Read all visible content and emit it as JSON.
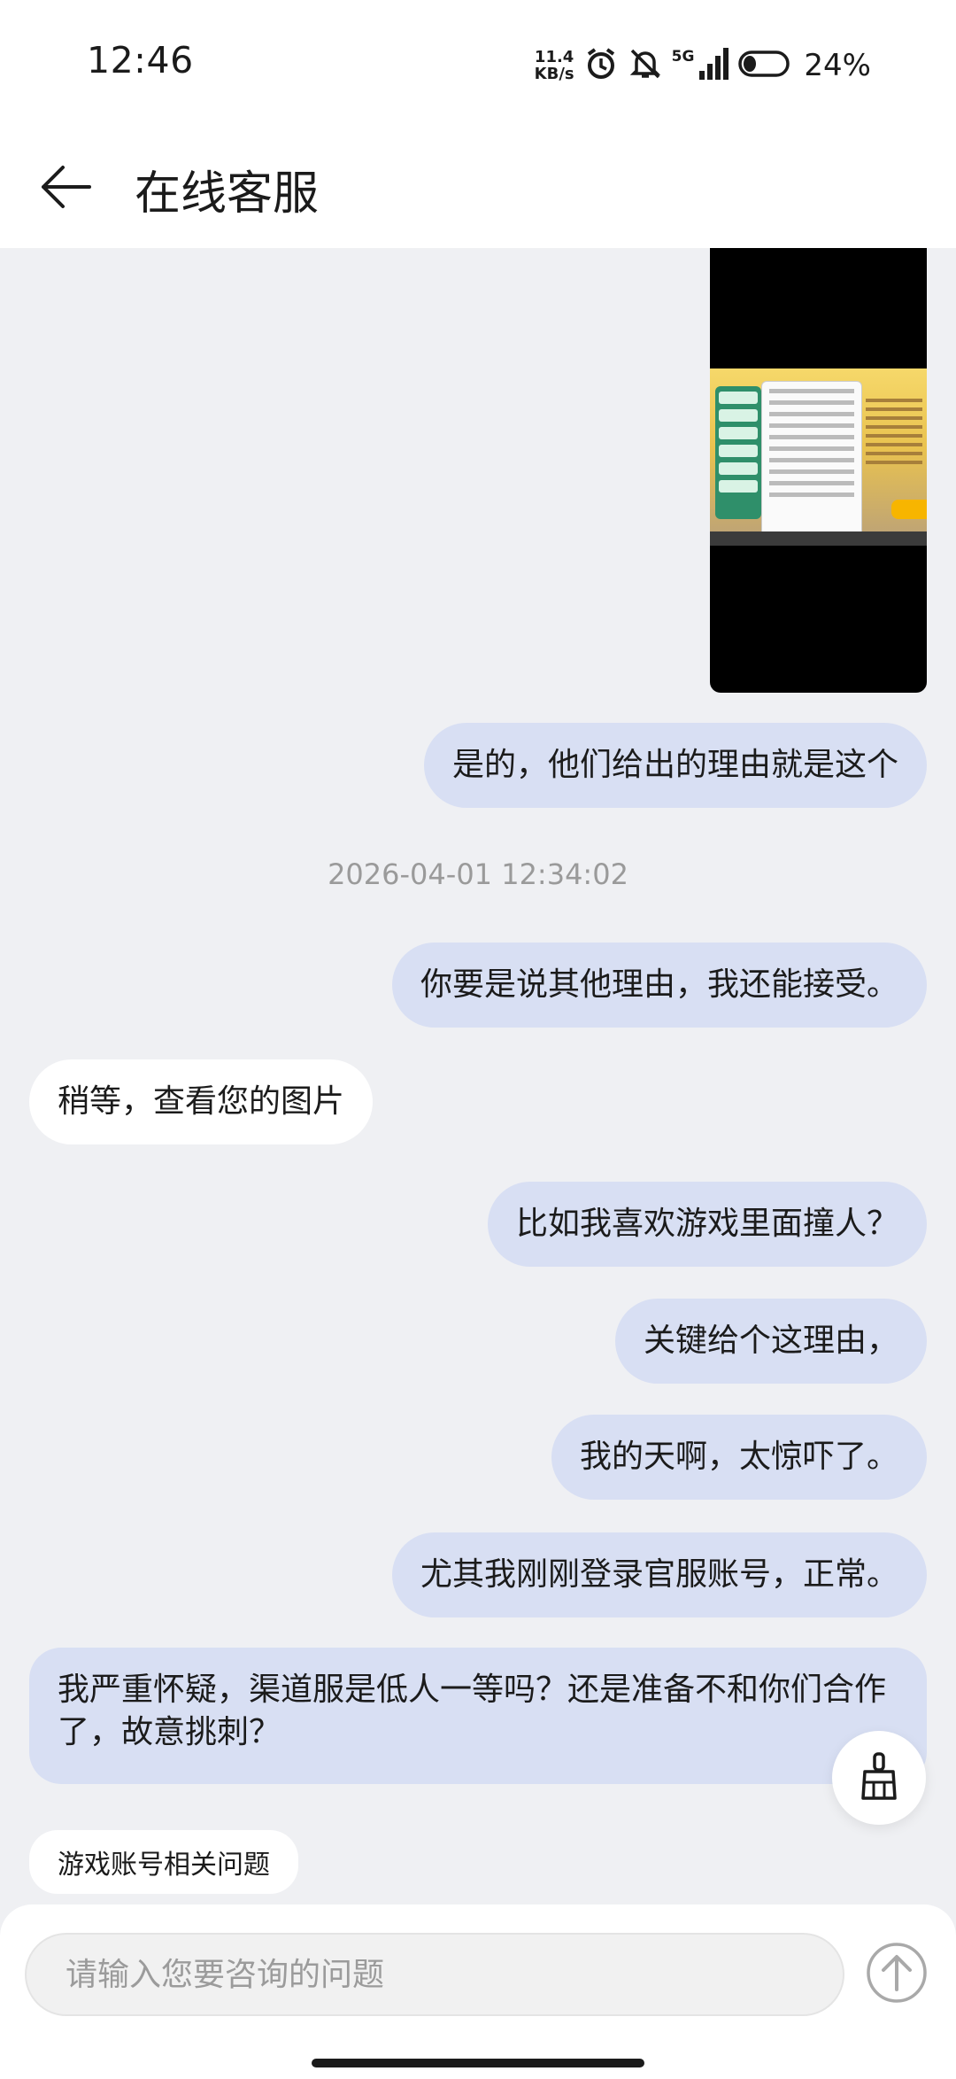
{
  "status_bar": {
    "time": "12:46",
    "net_speed_value": "11.4",
    "net_speed_unit": "KB/s",
    "signal_label": "5G",
    "battery_percent": "24%",
    "icons": [
      "alarm-icon",
      "bell-off-icon",
      "signal-icon",
      "battery-icon"
    ]
  },
  "header": {
    "title": "在线客服",
    "back_icon": "arrow-left-icon"
  },
  "messages": [
    {
      "sender": "me",
      "type": "image"
    },
    {
      "sender": "me",
      "text": "是的，他们给出的理由就是这个"
    },
    {
      "type": "timestamp",
      "text": "2026-04-01 12:34:02"
    },
    {
      "sender": "me",
      "text": "你要是说其他理由，我还能接受。"
    },
    {
      "sender": "agent",
      "text": "稍等，查看您的图片"
    },
    {
      "sender": "me",
      "text": "比如我喜欢游戏里面撞人？"
    },
    {
      "sender": "me",
      "text": "关键给个这理由，"
    },
    {
      "sender": "me",
      "text": "我的天啊，太惊吓了。"
    },
    {
      "sender": "me",
      "text": "尤其我刚刚登录官服账号，正常。"
    },
    {
      "sender": "me",
      "text": "我严重怀疑，渠道服是低人一等吗？还是准备不和你们合作了，故意挑刺？"
    }
  ],
  "quick_reply": {
    "label": "游戏账号相关问题"
  },
  "clear_button_icon": "broom-icon",
  "composer": {
    "placeholder": "请输入您要咨询的问题",
    "value": "",
    "send_icon": "arrow-up-circle-icon"
  },
  "colors": {
    "background": "#eff0f3",
    "my_bubble": "#d8dff3",
    "agent_bubble": "#ffffff",
    "timestamp": "#9a9a9a"
  }
}
